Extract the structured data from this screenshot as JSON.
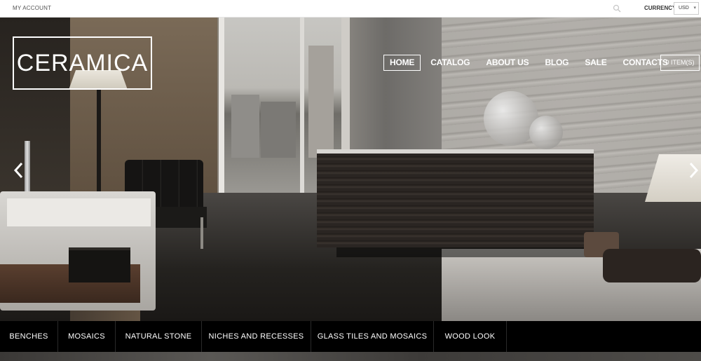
{
  "topbar": {
    "my_account": "MY ACCOUNT",
    "search_icon": "search-icon",
    "currency_label": "CURRENCY:",
    "currency_value": "USD"
  },
  "brand": {
    "logo_text": "CERAMICA"
  },
  "nav": {
    "items": [
      {
        "label": "HOME",
        "active": true
      },
      {
        "label": "CATALOG",
        "active": false
      },
      {
        "label": "ABOUT US",
        "active": false
      },
      {
        "label": "BLOG",
        "active": false
      },
      {
        "label": "SALE",
        "active": false
      },
      {
        "label": "CONTACTS",
        "active": false
      }
    ],
    "cart_label": "0 ITEM(S)"
  },
  "slider": {
    "prev_icon": "chevron-left-icon",
    "next_icon": "chevron-right-icon"
  },
  "categories": [
    "BENCHES",
    "MOSAICS",
    "NATURAL STONE",
    "NICHES AND RECESSES",
    "GLASS TILES AND MOSAICS",
    "WOOD LOOK"
  ],
  "colors": {
    "topbar_bg": "#ffffff",
    "nav_text": "#ffffff",
    "catbar_bg": "#000000"
  }
}
